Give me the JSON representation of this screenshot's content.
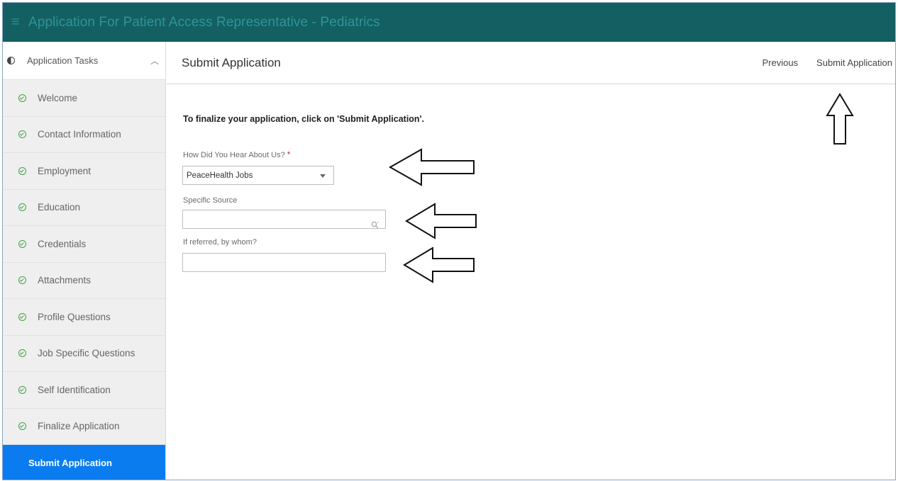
{
  "header": {
    "menu_icon": "hamburger-menu-icon",
    "title": "Application For Patient Access Representative - Pediatrics"
  },
  "sidebar": {
    "heading": "Application Tasks",
    "heading_icon": "half-circle-icon",
    "collapse_icon": "chevron-up-icon",
    "items": [
      {
        "label": "Welcome",
        "status": "complete"
      },
      {
        "label": "Contact Information",
        "status": "complete"
      },
      {
        "label": "Employment",
        "status": "complete"
      },
      {
        "label": "Education",
        "status": "complete"
      },
      {
        "label": "Credentials",
        "status": "complete"
      },
      {
        "label": "Attachments",
        "status": "complete"
      },
      {
        "label": "Profile Questions",
        "status": "complete"
      },
      {
        "label": "Job Specific Questions",
        "status": "complete"
      },
      {
        "label": "Self Identification",
        "status": "complete"
      },
      {
        "label": "Finalize Application",
        "status": "complete"
      },
      {
        "label": "Submit Application",
        "status": "active"
      }
    ]
  },
  "main": {
    "title": "Submit Application",
    "previous_label": "Previous",
    "submit_label": "Submit Application",
    "instruction": "To finalize your application, click on 'Submit Application'.",
    "fields": {
      "how_heard": {
        "label": "How Did You Hear About Us?",
        "required_mark": "*",
        "value": "PeaceHealth Jobs"
      },
      "specific_source": {
        "label": "Specific Source",
        "value": ""
      },
      "referred_by": {
        "label": "If referred, by whom?",
        "value": ""
      }
    }
  },
  "colors": {
    "topbar": "#135f62",
    "title_text": "#2d9598",
    "active_item": "#0a7cf0",
    "check": "#43a047",
    "required": "#d32f2f"
  }
}
